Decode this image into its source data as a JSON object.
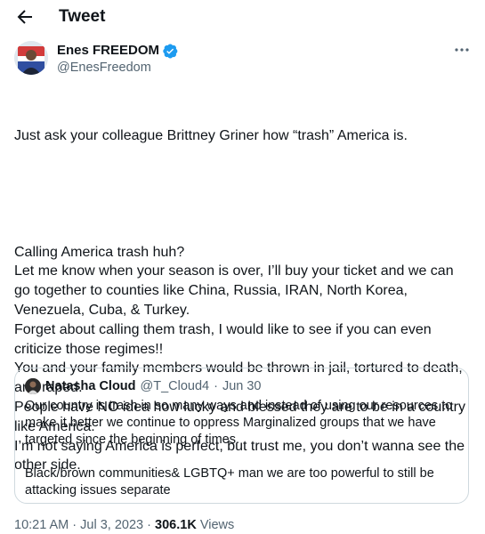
{
  "header": {
    "title": "Tweet",
    "back_icon": "arrow-left-icon"
  },
  "tweet": {
    "author": {
      "name": "Enes FREEDOM",
      "handle": "@EnesFreedom",
      "verified": true
    },
    "paragraphs": [
      "Just ask your colleague Brittney Griner how “trash” America is.",
      "Calling America trash huh?\nLet me know when your season is over, I’ll buy your ticket and we can go together to counties like China, Russia, IRAN, North Korea, Venezuela, Cuba, & Turkey.\nForget about calling them trash, I would like to see if you can even criticize those regimes!!\nYou and your family members would be thrown in jail, tortured to death, and raped.\nPeople have NO idea how lucky and blessed they are to be in a country like America.\nI’m not saying America is perfect, but trust me, you don’t wanna see the other side."
    ],
    "quote": {
      "name": "Natasha Cloud",
      "handle": "@T_Cloud4",
      "separator": "·",
      "date": "Jun 30",
      "paragraphs": [
        "Our country is trash in so many ways and instead of using our resources to make it better we continue to oppress Marginalized groups that we have targeted since the beginning of times.",
        "Black/brown communities& LGBTQ+ man we are too powerful to still be attacking issues separate"
      ]
    },
    "footer": {
      "time": "10:21 AM",
      "separator": "·",
      "date": "Jul 3, 2023",
      "views_count": "306.1K",
      "views_label": "Views"
    }
  },
  "colors": {
    "text": "#0f1419",
    "secondary": "#536471",
    "verified": "#1d9bf0",
    "border": "#cfd9de"
  }
}
